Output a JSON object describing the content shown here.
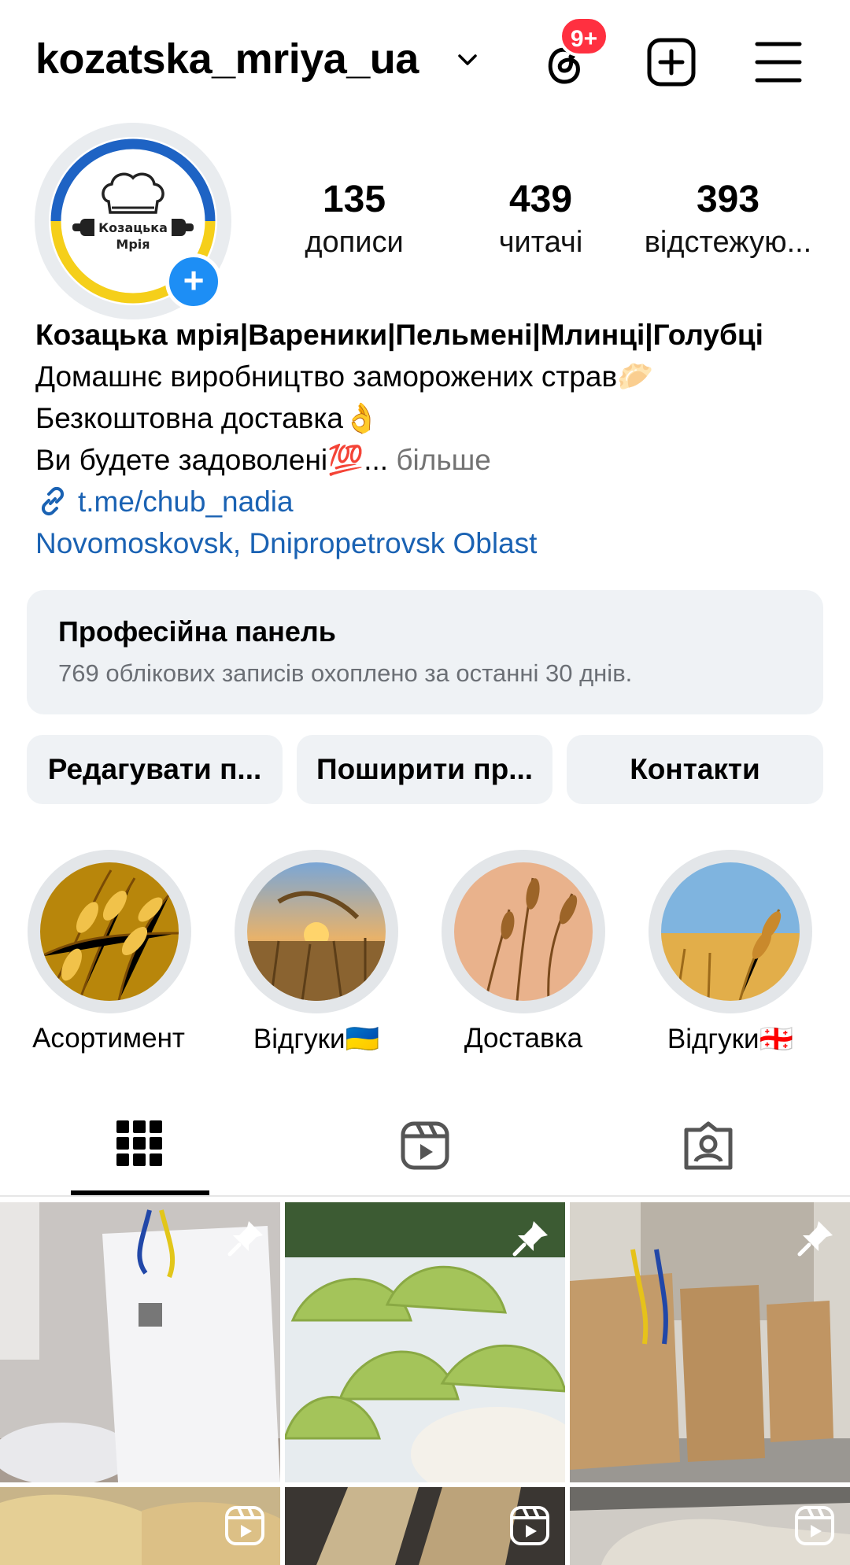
{
  "header": {
    "username": "kozatska_mriya_ua",
    "threads_badge": "9+",
    "icons": [
      "chevron-down-icon",
      "threads-icon",
      "add-post-icon",
      "menu-icon"
    ]
  },
  "profile": {
    "avatar_text": [
      "Козацька",
      "Мрія"
    ],
    "stats": [
      {
        "value": "135",
        "label": "дописи"
      },
      {
        "value": "439",
        "label": "читачі"
      },
      {
        "value": "393",
        "label": "відстежую..."
      }
    ],
    "name": "Козацька мрія|Вареники|Пельмені|Млинці|Голубці",
    "bio_line1": "Домашнє виробництво заморожених страв🥟",
    "bio_line2": "Безкоштовна доставка👌",
    "bio_line3": "Ви будете задоволені💯...",
    "bio_more": " більше",
    "link": "t.me/chub_nadia",
    "location": "Novomoskovsk, Dnipropetrovsk Oblast"
  },
  "pro_panel": {
    "title": "Професійна панель",
    "subtitle": "769 облікових записів охоплено за останні 30 днів."
  },
  "buttons": {
    "edit": "Редагувати п...",
    "share": "Поширити пр...",
    "contacts": "Контакти"
  },
  "highlights": [
    {
      "label": "Асортимент"
    },
    {
      "label": "Відгуки🇺🇦"
    },
    {
      "label": "Доставка"
    },
    {
      "label": "Відгуки🇬🇪"
    }
  ],
  "tabs": [
    "grid-icon",
    "reels-icon",
    "tagged-icon"
  ],
  "colors": {
    "accent": "#1d8ef5",
    "badge": "#ff3040",
    "link": "#1a62b3",
    "panel_bg": "#eff2f5"
  }
}
